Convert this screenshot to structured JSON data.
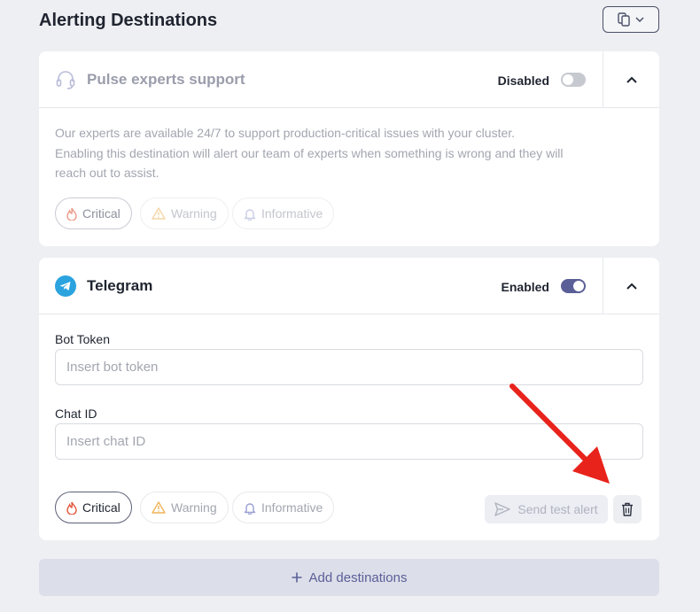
{
  "header": {
    "title": "Alerting Destinations",
    "menu_icon": "copy-icon"
  },
  "pulse": {
    "title": "Pulse experts support",
    "icon": "headset-icon",
    "status": "Disabled",
    "enabled": false,
    "description_lines": [
      "Our experts are available 24/7 to support production-critical issues with your cluster.",
      "Enabling this destination will alert our team of experts when something is wrong and they will",
      "reach out to assist."
    ],
    "severities": {
      "critical": "Critical",
      "warning": "Warning",
      "informative": "Informative"
    }
  },
  "telegram": {
    "title": "Telegram",
    "icon": "telegram-icon",
    "status": "Enabled",
    "enabled": true,
    "bot_token": {
      "label": "Bot Token",
      "placeholder": "Insert bot token",
      "value": ""
    },
    "chat_id": {
      "label": "Chat ID",
      "placeholder": "Insert chat ID",
      "value": ""
    },
    "severities": {
      "critical": "Critical",
      "warning": "Warning",
      "informative": "Informative"
    },
    "send_test_label": "Send test alert"
  },
  "add_destinations_label": "Add destinations",
  "colors": {
    "accent": "#5b5f97",
    "toggle_on": "#5b5f97",
    "toggle_off": "#c7c9d0",
    "critical": "#e2553a",
    "annotation": "#e8231b"
  }
}
